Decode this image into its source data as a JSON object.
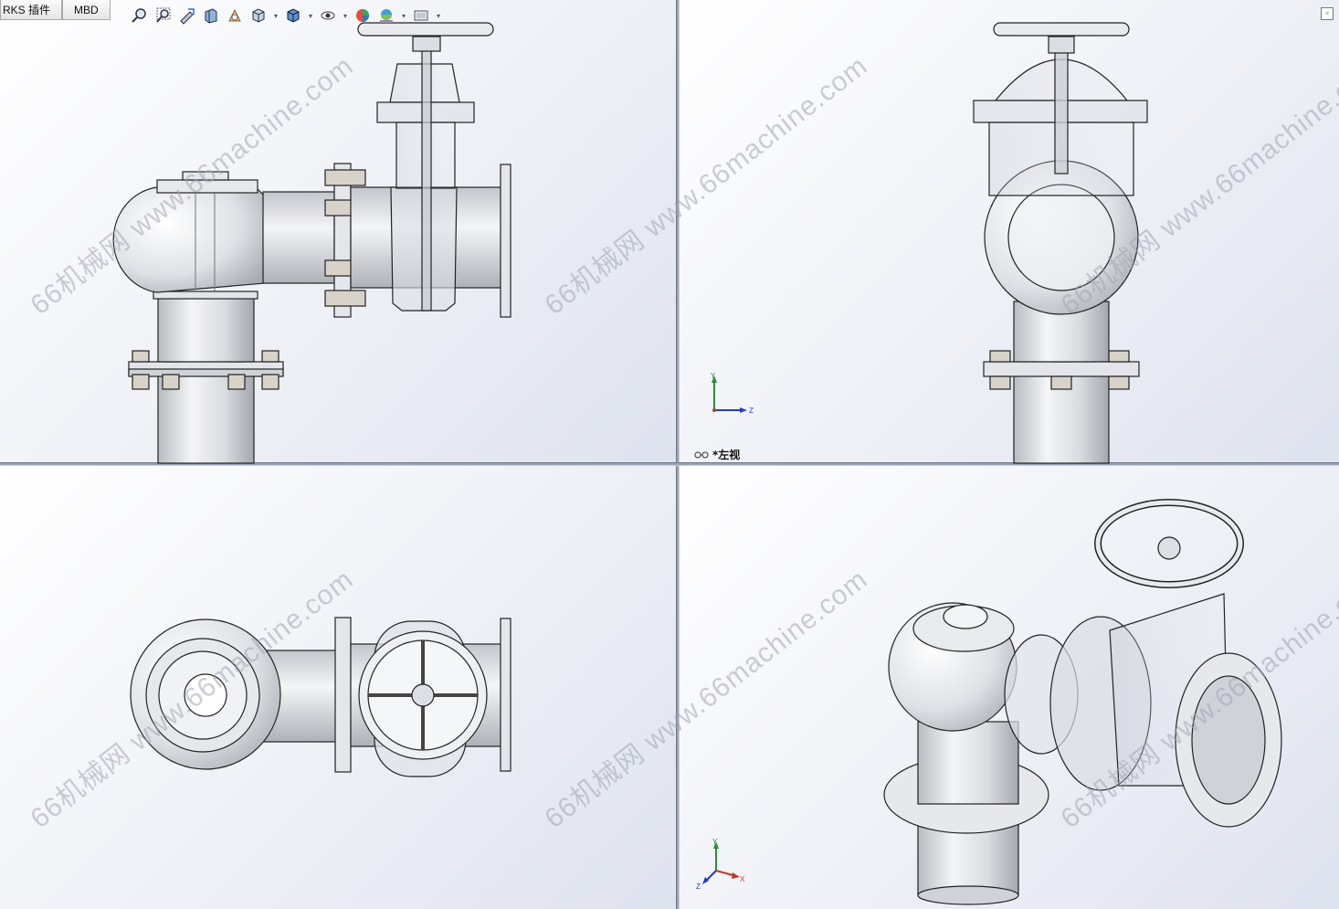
{
  "tabs": [
    {
      "label": "RKS 插件"
    },
    {
      "label": "MBD"
    }
  ],
  "toolbar": {
    "icons": [
      "zoom-to-fit-icon",
      "zoom-to-area-icon",
      "previous-view-icon",
      "section-view-icon",
      "dynamic-annotation-icon",
      "view-orientation-icon",
      "display-style-icon",
      "hide-show-items-icon",
      "edit-appearance-icon",
      "apply-scene-icon",
      "view-settings-icon"
    ]
  },
  "watermark": {
    "text": "66机械网 www.66machine.com"
  },
  "viewports": {
    "top_right": {
      "view_label": "*左视"
    }
  },
  "triad": {
    "x": "X",
    "y": "Y",
    "z": "Z"
  },
  "colors": {
    "background_top": "#ffffff",
    "background_bottom": "#dfe3ef",
    "x_axis": "#c0392b",
    "y_axis": "#2e8b3d",
    "z_axis": "#1f3fbf"
  }
}
